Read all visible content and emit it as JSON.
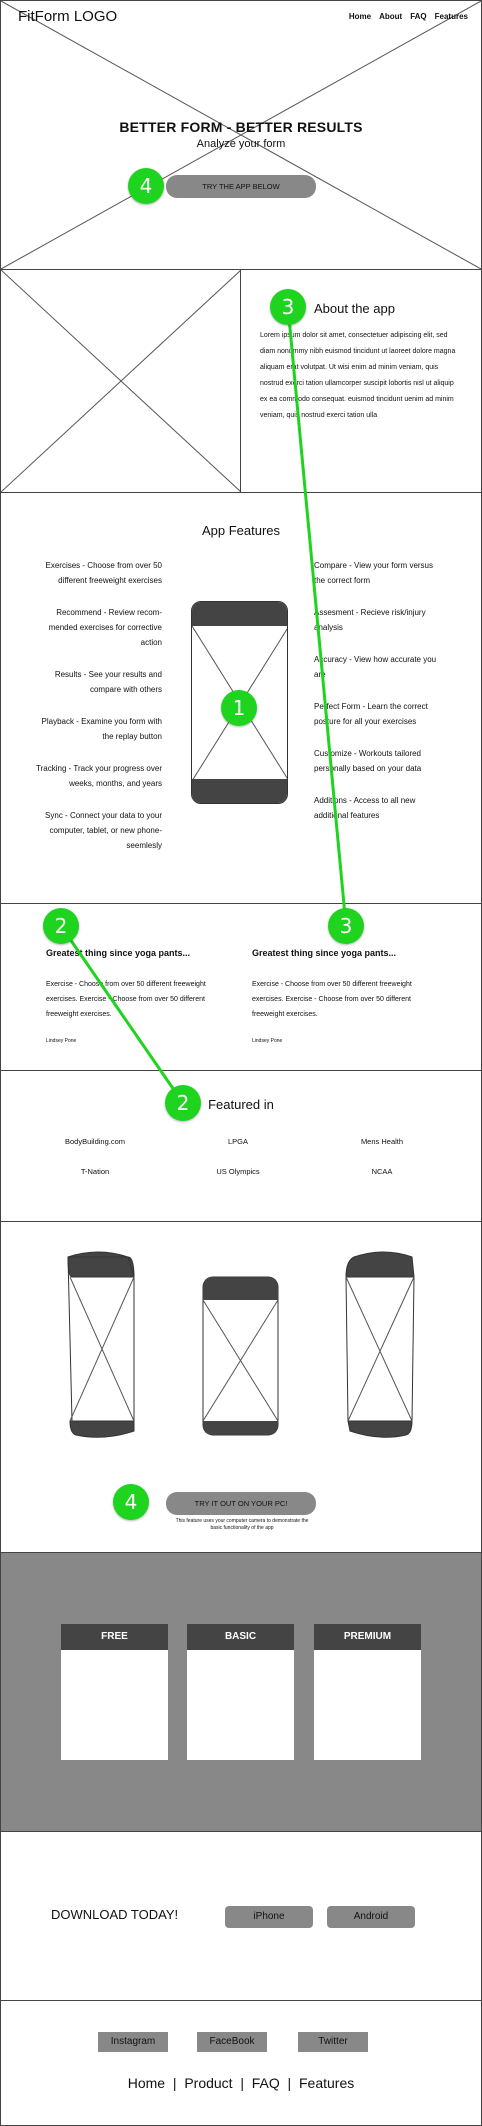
{
  "header": {
    "logo": "FitForm LOGO",
    "nav": [
      "Home",
      "About",
      "FAQ",
      "Features"
    ]
  },
  "hero": {
    "title": "BETTER FORM - BETTER RESULTS",
    "subtitle": "Analyze your form",
    "cta": "TRY THE APP BELOW"
  },
  "about": {
    "title": "About the app",
    "body": "Lorem ipsum dolor sit amet, consectetuer adipiscing elit, sed diam nonummy nibh euismod tincidunt ut laoreet dolore magna aliquam erat volutpat. Ut wisi enim ad minim veniam, quis nostrud exerci tation ullamcorper suscipit lobortis nisl ut aliquip ex ea commodo consequat. euismod tincidunt uenim ad minim veniam, quis nostrud exerci tation ulla"
  },
  "features": {
    "title": "App Features",
    "left": [
      "Exercises - Choose from over 50 different freeweight exercises",
      "Recommend - Review recom-mended exercises for corrective action",
      "Results - See your results and compare with others",
      "Playback - Examine you form with the replay button",
      "Tracking - Track your progress over weeks, months, and years",
      "Sync - Connect your data to your computer, tablet, or new phone-seemlesly"
    ],
    "right": [
      "Compare - View your form versus the correct form",
      "Assesment - Recieve risk/injury analysis",
      "Accuracy - View how accurate you are",
      "Perfect Form - Learn the correct posture for all your exercises",
      "Customize - Workouts tailored personally based on your data",
      "Additions - Access to all new additional features"
    ]
  },
  "testimonials": [
    {
      "title": "Greatest thing since yoga pants...",
      "body": "Exercise - Choose from over 50 different freeweight exercises. Exercise - Choose from over 50 different freeweight exercises.",
      "author": "Lindsey Pone"
    },
    {
      "title": "Greatest thing since yoga pants...",
      "body": "Exercise - Choose from over 50 different freeweight exercises. Exercise - Choose from over 50 different freeweight exercises.",
      "author": "Lindsey Pone"
    }
  ],
  "featured": {
    "title": "Featured in",
    "brands": [
      "BodyBuilding.com",
      "LPGA",
      "Mens Health",
      "T-Nation",
      "US Olympics",
      "NCAA"
    ]
  },
  "pc": {
    "cta": "TRY IT OUT ON YOUR PC!",
    "note": "This feature uses your computer camera to demonstrate the basic functionality of the app"
  },
  "pricing": {
    "plans": [
      "FREE",
      "BASIC",
      "PREMIUM"
    ]
  },
  "download": {
    "text": "DOWNLOAD TODAY!",
    "buttons": [
      "iPhone",
      "Android"
    ]
  },
  "footer": {
    "social": [
      "Instagram",
      "FaceBook",
      "Twitter"
    ],
    "nav": [
      "Home",
      "Product",
      "FAQ",
      "Features"
    ]
  },
  "annotations": {
    "markers": [
      "4",
      "3",
      "1",
      "2",
      "3",
      "2",
      "4"
    ],
    "color": "#1ed41e"
  }
}
